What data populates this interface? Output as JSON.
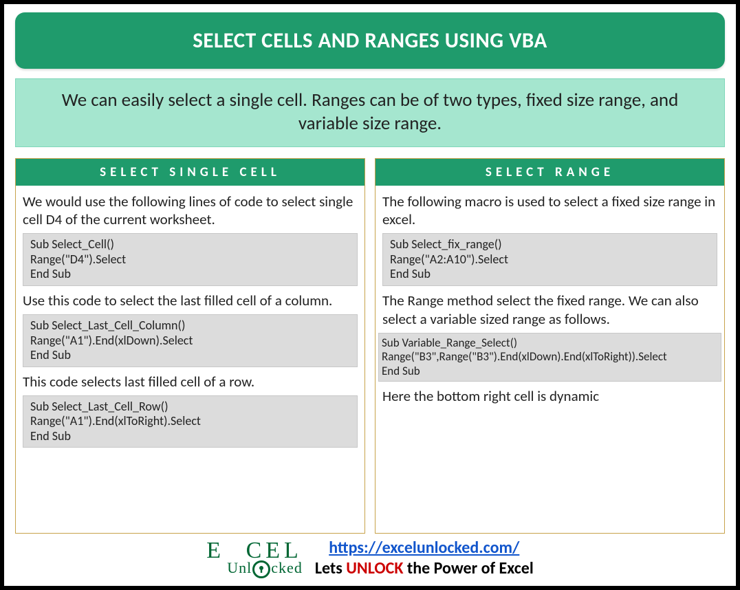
{
  "title": "SELECT CELLS AND RANGES USING VBA",
  "subtitle": "We can easily select a single cell. Ranges can be of two types, fixed size range, and variable size range.",
  "left": {
    "head": "SELECT SINGLE CELL",
    "p1": "We would use the following lines of code to select single cell D4 of the current worksheet.",
    "code1": "Sub Select_Cell()\nRange(\"D4\").Select\nEnd Sub",
    "p2": "Use this code to select the last filled cell of a column.",
    "code2": "Sub Select_Last_Cell_Column()\nRange(\"A1\").End(xlDown).Select\nEnd Sub",
    "p3": "This code selects last filled cell of a row.",
    "code3": "Sub Select_Last_Cell_Row()\nRange(\"A1\").End(xlToRight).Select\nEnd Sub"
  },
  "right": {
    "head": "SELECT RANGE",
    "p1": "The following macro is used to select a fixed size range in excel.",
    "code1": "Sub Select_fix_range()\nRange(\"A2:A10\").Select\nEnd Sub",
    "p2": "The Range method select the fixed range. We can also select a variable sized range as follows.",
    "code2": "Sub Variable_Range_Select()\nRange(\"B3\",Range(\"B3\").End(xlDown).End(xlToRight)).Select\nEnd Sub",
    "p3": "Here the bottom right cell is dynamic"
  },
  "footer": {
    "logo_top_left": "E",
    "logo_top_right": "CEL",
    "logo_bottom_pre": "Unl",
    "logo_bottom_post": "cked",
    "url": "https://excelunlocked.com/",
    "tagline_pre": "Lets ",
    "tagline_unlock": "UNLOCK",
    "tagline_post": " the Power of Excel"
  }
}
